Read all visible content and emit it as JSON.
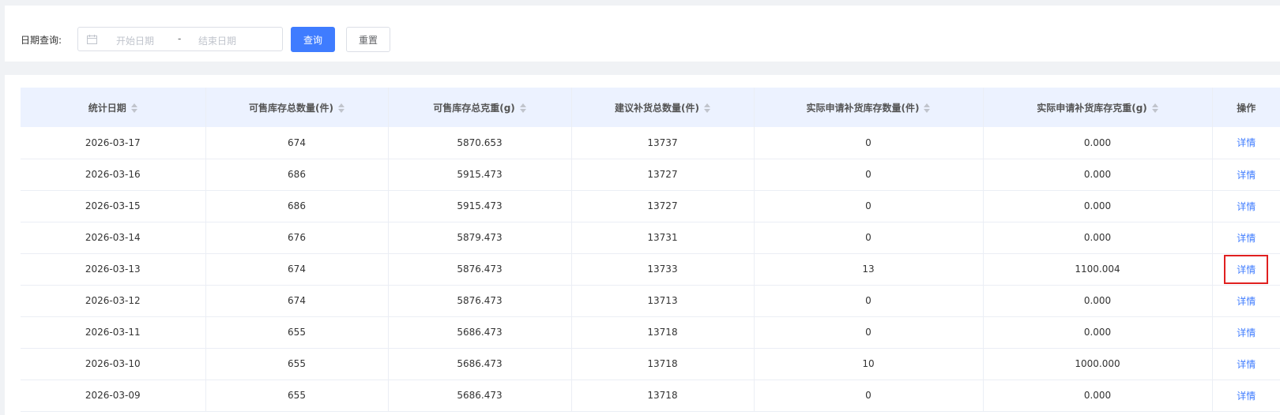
{
  "filter": {
    "label": "日期查询:",
    "start_placeholder": "开始日期",
    "separator": "-",
    "end_placeholder": "结束日期",
    "query_label": "查询",
    "reset_label": "重置"
  },
  "table": {
    "headers": [
      "统计日期",
      "可售库存总数量(件)",
      "可售库存总克重(g)",
      "建议补货总数量(件)",
      "实际申请补货库存数量(件)",
      "实际申请补货库存克重(g)",
      "操作"
    ],
    "rows": [
      [
        "2026-03-17",
        "674",
        "5870.653",
        "13737",
        "0",
        "0.000",
        "详情"
      ],
      [
        "2026-03-16",
        "686",
        "5915.473",
        "13727",
        "0",
        "0.000",
        "详情"
      ],
      [
        "2026-03-15",
        "686",
        "5915.473",
        "13727",
        "0",
        "0.000",
        "详情"
      ],
      [
        "2026-03-14",
        "676",
        "5879.473",
        "13731",
        "0",
        "0.000",
        "详情"
      ],
      [
        "2026-03-13",
        "674",
        "5876.473",
        "13733",
        "13",
        "1100.004",
        "详情"
      ],
      [
        "2026-03-12",
        "674",
        "5876.473",
        "13713",
        "0",
        "0.000",
        "详情"
      ],
      [
        "2026-03-11",
        "655",
        "5686.473",
        "13718",
        "0",
        "0.000",
        "详情"
      ],
      [
        "2026-03-10",
        "655",
        "5686.473",
        "13718",
        "10",
        "1000.000",
        "详情"
      ],
      [
        "2026-03-09",
        "655",
        "5686.473",
        "13718",
        "0",
        "0.000",
        "详情"
      ]
    ],
    "highlighted_row": 4
  },
  "colors": {
    "primary": "#3f7cff",
    "header_bg": "#ecf2ff",
    "highlight": "#e02020"
  }
}
